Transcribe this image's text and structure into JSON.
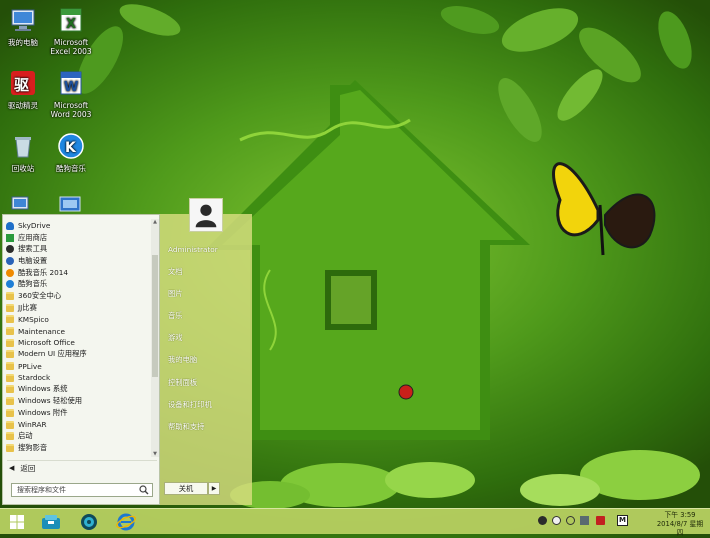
{
  "desktop_icons": [
    {
      "label": "我的电脑",
      "icon": "computer-icon"
    },
    {
      "label": "Microsoft Excel 2003",
      "icon": "excel-icon"
    },
    {
      "label": "驱动精灵",
      "icon": "driver-genius-icon"
    },
    {
      "label": "Microsoft Word 2003",
      "icon": "word-icon"
    },
    {
      "label": "回收站",
      "icon": "recycle-bin-icon"
    },
    {
      "label": "酷狗音乐",
      "icon": "kugou-icon"
    }
  ],
  "start_menu": {
    "programs": [
      {
        "label": "SkyDrive",
        "icon": "cloud-icon",
        "color": "#1e6fc9"
      },
      {
        "label": "应用商店",
        "icon": "store-icon",
        "color": "#2a9a3c"
      },
      {
        "label": "搜索工具",
        "icon": "search-tool-icon",
        "color": "#2b2b2b"
      },
      {
        "label": "电脑设置",
        "icon": "gear-icon",
        "color": "#2a63b8"
      },
      {
        "label": "酷我音乐 2014",
        "icon": "kuwo-icon",
        "color": "#f08a00"
      },
      {
        "label": "酷狗音乐",
        "icon": "kugou-icon",
        "color": "#1f7fd6"
      },
      {
        "label": "360安全中心",
        "icon": "folder-icon"
      },
      {
        "label": "JJ比赛",
        "icon": "folder-icon"
      },
      {
        "label": "KMSpico",
        "icon": "folder-icon"
      },
      {
        "label": "Maintenance",
        "icon": "folder-icon"
      },
      {
        "label": "Microsoft Office",
        "icon": "folder-icon"
      },
      {
        "label": "Modern UI 应用程序",
        "icon": "folder-icon"
      },
      {
        "label": "PPLive",
        "icon": "folder-icon"
      },
      {
        "label": "Stardock",
        "icon": "folder-icon"
      },
      {
        "label": "Windows 系统",
        "icon": "folder-icon"
      },
      {
        "label": "Windows 轻松使用",
        "icon": "folder-icon"
      },
      {
        "label": "Windows 附件",
        "icon": "folder-icon"
      },
      {
        "label": "WinRAR",
        "icon": "folder-icon"
      },
      {
        "label": "启动",
        "icon": "folder-icon"
      },
      {
        "label": "搜狗影音",
        "icon": "folder-icon"
      }
    ],
    "back_label": "返回",
    "search_placeholder": "搜索程序和文件",
    "user_name": "Administrator",
    "right_items": [
      "文档",
      "图片",
      "音乐",
      "游戏",
      "我的电脑",
      "控制面板",
      "设备和打印机",
      "帮助和支持"
    ],
    "shutdown_label": "关机"
  },
  "taskbar": {
    "pinned": [
      "start-icon",
      "file-explorer-icon",
      "media-player-icon",
      "internet-explorer-icon"
    ],
    "clock_time": "下午 3:59",
    "clock_date": "2014/8/7 星期四"
  },
  "colors": {
    "start_right_bg": "#d8de80",
    "taskbar_bg": "#bcd464",
    "wallpaper_green": "#4f9a1b",
    "butterfly_yellow": "#f2d40c"
  }
}
